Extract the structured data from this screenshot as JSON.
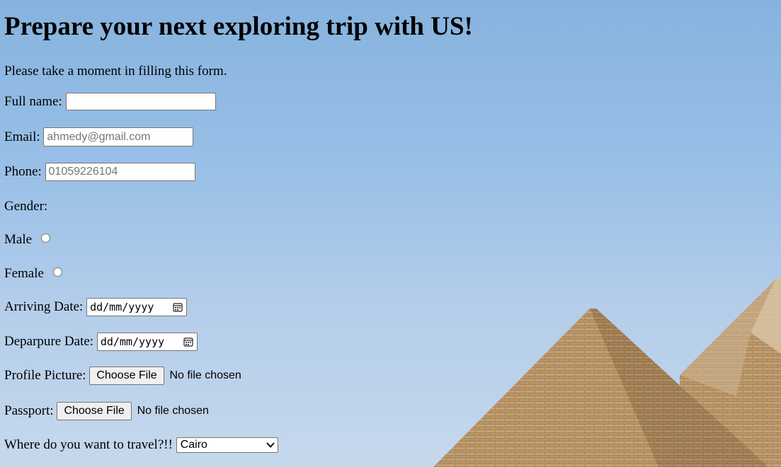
{
  "page": {
    "title": "Prepare your next exploring trip with US!",
    "intro": "Please take a moment in filling this form."
  },
  "form": {
    "full_name": {
      "label": "Full name:",
      "value": "",
      "placeholder": ""
    },
    "email": {
      "label": "Email:",
      "value": "",
      "placeholder": "ahmedy@gmail.com"
    },
    "phone": {
      "label": "Phone:",
      "value": "",
      "placeholder": "01059226104"
    },
    "gender": {
      "label": "Gender:",
      "options": [
        {
          "label": "Male",
          "checked": false
        },
        {
          "label": "Female",
          "checked": false
        }
      ]
    },
    "arriving_date": {
      "label": "Arriving Date:",
      "placeholder": "dd/mm/yyyy"
    },
    "departure_date": {
      "label": "Deparpure Date:",
      "placeholder": "dd/mm/yyyy"
    },
    "profile_picture": {
      "label": "Profile Picture:",
      "button": "Choose File",
      "status": "No file chosen"
    },
    "passport": {
      "label": "Passport:",
      "button": "Choose File",
      "status": "No file chosen"
    },
    "destination": {
      "label": "Where do you want to travel?!!",
      "selected": "Cairo"
    }
  },
  "icons": {
    "calendar": "calendar-icon",
    "dropdown": "chevron-down-icon",
    "background": "pyramids-image"
  },
  "colors": {
    "sky_top": "#86b3de",
    "sky_bottom": "#c6d8ec",
    "stone": "#b08d62"
  }
}
